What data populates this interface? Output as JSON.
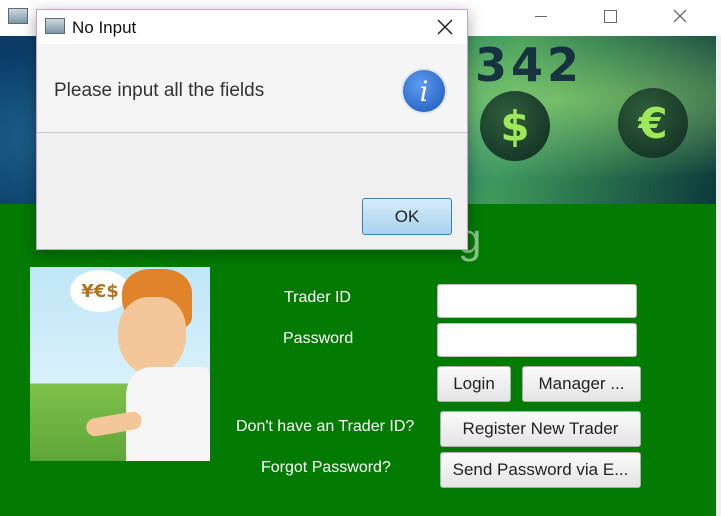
{
  "main_window": {
    "banner": {
      "digits": "342",
      "coin_symbols": [
        "$",
        "€"
      ]
    },
    "heading_fragment": "g",
    "cartoon": {
      "bubble_text": "¥€$"
    },
    "form": {
      "trader_id_label": "Trader ID",
      "trader_id_value": "",
      "password_label": "Password",
      "password_value": "",
      "login_button": "Login",
      "manager_button": "Manager ...",
      "no_id_label": "Don't have an Trader ID?",
      "register_button": "Register New Trader",
      "forgot_label": "Forgot Password?",
      "send_password_button": "Send Password via E..."
    }
  },
  "dialog": {
    "title": "No Input",
    "message": "Please input all the fields",
    "info_icon_glyph": "i",
    "ok_button": "OK"
  },
  "colors": {
    "content_green": "#037b03",
    "dialog_border": "#c9a0d6",
    "ok_button_border": "#3c7fb1",
    "info_icon_blue": "#1a55b8"
  },
  "icons": [
    "app-window-icon",
    "minimize-icon",
    "maximize-icon",
    "close-icon",
    "info-icon"
  ]
}
